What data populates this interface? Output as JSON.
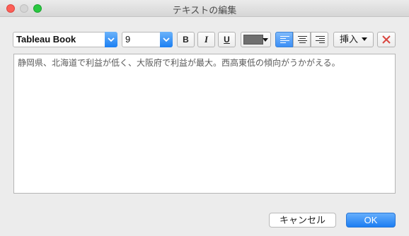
{
  "window": {
    "title": "テキストの編集"
  },
  "toolbar": {
    "font_family": "Tableau Book",
    "font_size": "9",
    "bold_label": "B",
    "italic_label": "I",
    "underline_label": "U",
    "text_color": "#6f6f6f",
    "insert_label": "挿入",
    "accent_color": "#1b7ff3",
    "clear_icon_color": "#d9463f"
  },
  "editor": {
    "text": "静岡県、北海道で利益が低く、大阪府で利益が最大。西高東低の傾向がうかがえる。"
  },
  "footer": {
    "cancel_label": "キャンセル",
    "ok_label": "OK"
  }
}
